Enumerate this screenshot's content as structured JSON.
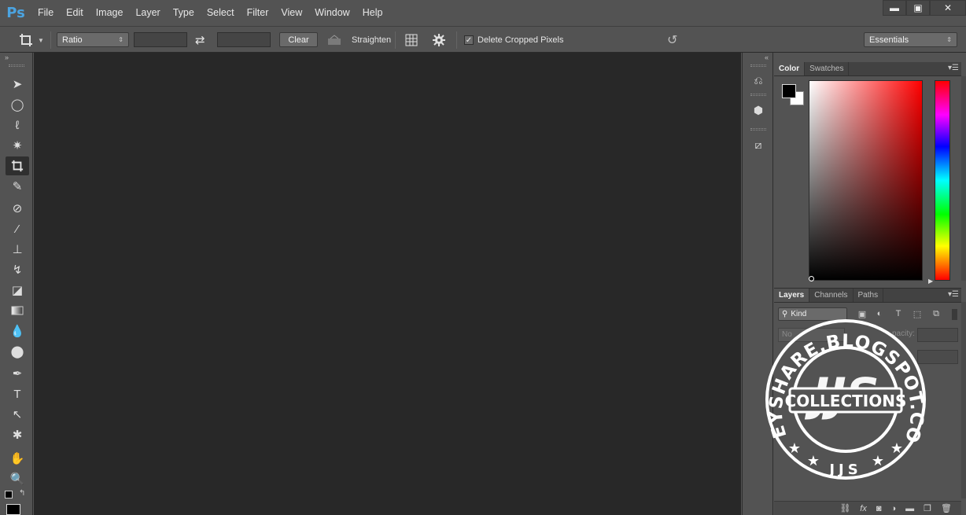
{
  "app": {
    "logo": "Ps"
  },
  "menu": [
    "File",
    "Edit",
    "Image",
    "Layer",
    "Type",
    "Select",
    "Filter",
    "View",
    "Window",
    "Help"
  ],
  "window_controls": {
    "minimize": "▬",
    "maximize": "▣",
    "close": "✕"
  },
  "options": {
    "ratio_label": "Ratio",
    "width_value": "",
    "height_value": "",
    "swap_glyph": "⇄",
    "clear_label": "Clear",
    "straighten_label": "Straighten",
    "delete_cropped_label": "Delete Cropped Pixels",
    "delete_cropped_checked": true,
    "workspace_label": "Essentials"
  },
  "color_panel": {
    "tabs": [
      "Color",
      "Swatches"
    ],
    "active_tab": "Color",
    "foreground": "#000000",
    "background": "#ffffff"
  },
  "layers_panel": {
    "tabs": [
      "Layers",
      "Channels",
      "Paths"
    ],
    "active_tab": "Layers",
    "filter_label": "Kind",
    "blend_mode": "No",
    "opacity_label": "pacity:"
  },
  "watermark": {
    "ring_text": "JOEYSHARE.BLOGSPOT.COM",
    "banner_text": "COLLECTIONS",
    "bottom_text": "JJS",
    "monogram": "JJS"
  }
}
